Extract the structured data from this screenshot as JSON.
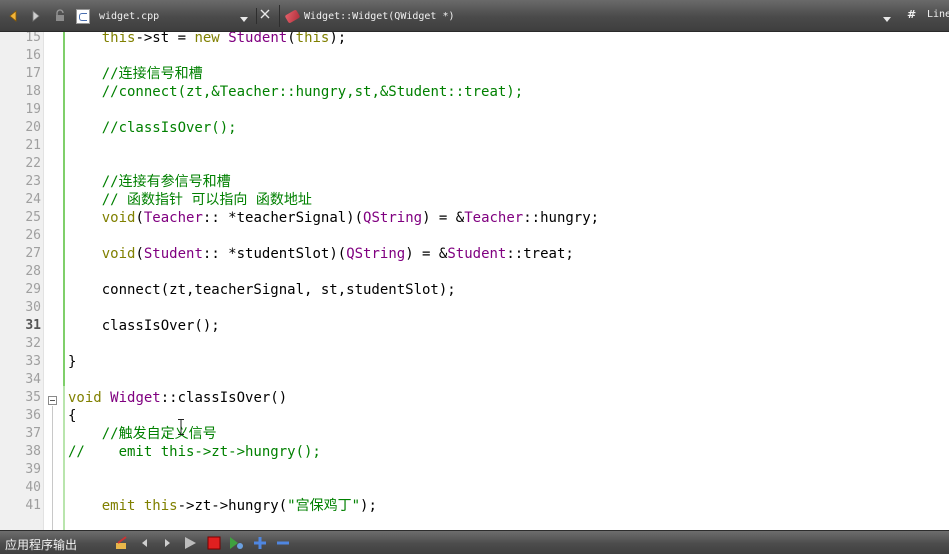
{
  "toolbar": {
    "file_name": "widget.cpp",
    "symbol_name": "Widget::Widget(QWidget *)",
    "hash_label": "#",
    "line_label": "Line"
  },
  "editor": {
    "current_line": "31",
    "lines": [
      {
        "no": "15",
        "code": "    this->st = new Student(this);"
      },
      {
        "no": "16",
        "code": ""
      },
      {
        "no": "17",
        "code": "    //连接信号和槽"
      },
      {
        "no": "18",
        "code": "    //connect(zt,&Teacher::hungry,st,&Student::treat);"
      },
      {
        "no": "19",
        "code": ""
      },
      {
        "no": "20",
        "code": "    //classIsOver();"
      },
      {
        "no": "21",
        "code": ""
      },
      {
        "no": "22",
        "code": ""
      },
      {
        "no": "23",
        "code": "    //连接有参信号和槽"
      },
      {
        "no": "24",
        "code": "    // 函数指针 可以指向 函数地址"
      },
      {
        "no": "25",
        "code": "    void(Teacher:: *teacherSignal)(QString) = &Teacher::hungry;"
      },
      {
        "no": "26",
        "code": ""
      },
      {
        "no": "27",
        "code": "    void(Student:: *studentSlot)(QString) = &Student::treat;"
      },
      {
        "no": "28",
        "code": ""
      },
      {
        "no": "29",
        "code": "    connect(zt,teacherSignal, st,studentSlot);"
      },
      {
        "no": "30",
        "code": ""
      },
      {
        "no": "31",
        "code": "    classIsOver();"
      },
      {
        "no": "32",
        "code": ""
      },
      {
        "no": "33",
        "code": "}"
      },
      {
        "no": "34",
        "code": ""
      },
      {
        "no": "35",
        "code": "void Widget::classIsOver()"
      },
      {
        "no": "36",
        "code": "{"
      },
      {
        "no": "37",
        "code": "    //触发自定义信号"
      },
      {
        "no": "38",
        "code": "//    emit this->zt->hungry();"
      },
      {
        "no": "39",
        "code": ""
      },
      {
        "no": "40",
        "code": ""
      },
      {
        "no": "41",
        "code": "    emit this->zt->hungry(\"宫保鸡丁\");"
      }
    ]
  },
  "bottombar": {
    "output_tab_label": "应用程序输出"
  },
  "colors": {
    "comment": "#008000",
    "keyword": "#808000",
    "type": "#800080",
    "change_marker": "#7fcf6a"
  },
  "icons": [
    "back-arrow-icon",
    "forward-arrow-icon",
    "lock-icon",
    "cpp-file-icon",
    "dropdown-arrow-icon",
    "close-icon",
    "symbol-icon",
    "clear-output-icon",
    "previous-item-icon",
    "next-item-icon",
    "run-icon",
    "stop-icon",
    "attach-icon",
    "zoom-in-icon",
    "zoom-out-icon"
  ]
}
